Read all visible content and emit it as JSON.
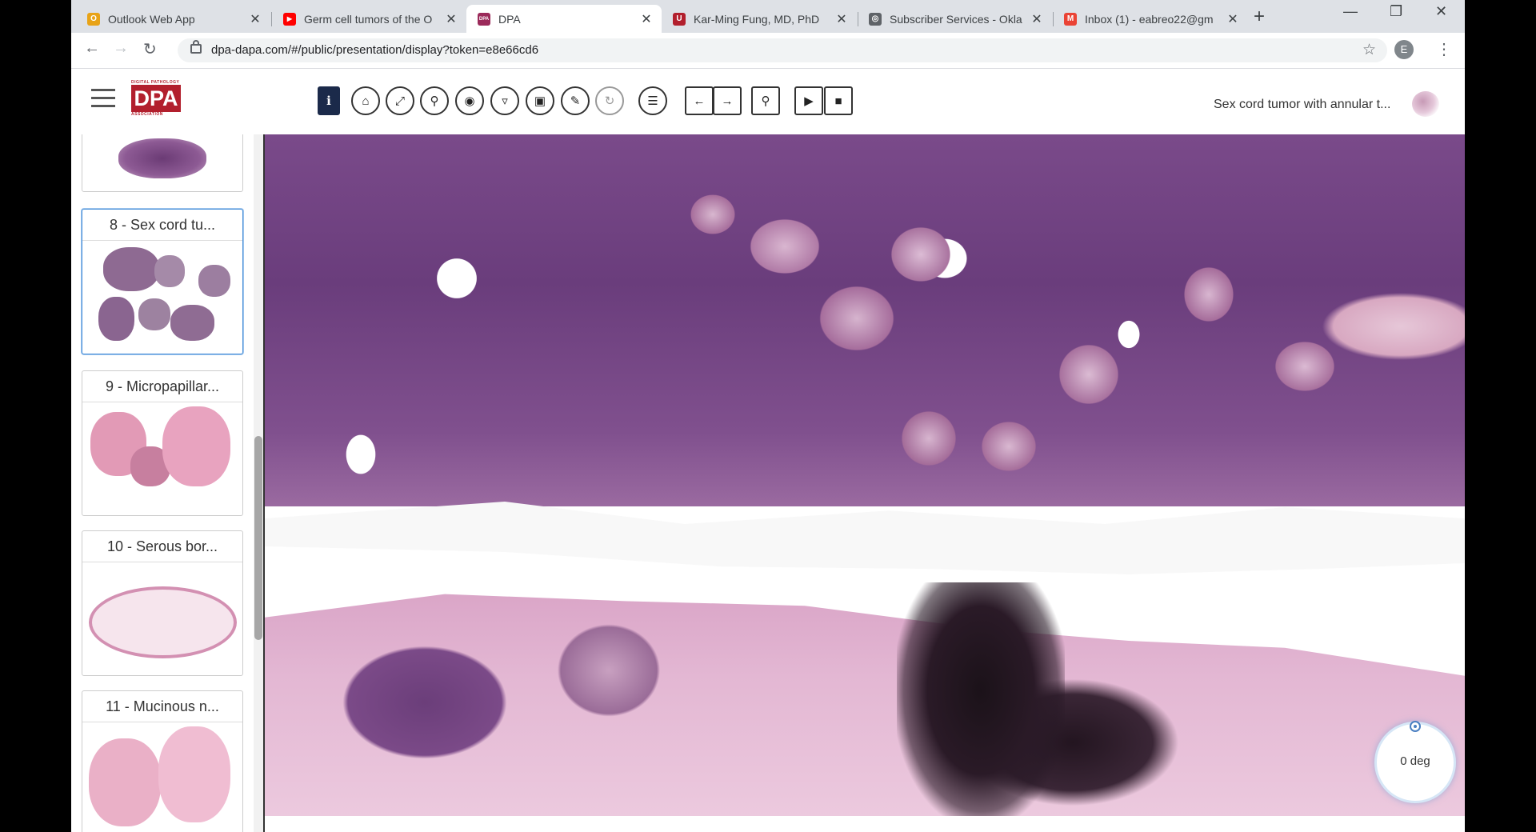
{
  "browser": {
    "tabs": [
      {
        "title": "Outlook Web App",
        "favicon": "outlook-icon",
        "fav_color": "#e8a317",
        "fav_text": "O"
      },
      {
        "title": "Germ cell tumors of the O",
        "favicon": "youtube-icon",
        "fav_color": "#ff0000",
        "fav_text": "▶"
      },
      {
        "title": "DPA",
        "favicon": "dpa-icon",
        "fav_color": "#9b2a5a",
        "fav_text": "DPA",
        "active": true
      },
      {
        "title": "Kar-Ming Fung, MD, PhD",
        "favicon": "ou-icon",
        "fav_color": "#b21f2d",
        "fav_text": "U"
      },
      {
        "title": "Subscriber Services - Okla",
        "favicon": "globe-icon",
        "fav_color": "#5f6368",
        "fav_text": "◎"
      },
      {
        "title": "Inbox (1) - eabreo22@gm",
        "favicon": "gmail-icon",
        "fav_color": "#ea4335",
        "fav_text": "M"
      }
    ],
    "new_tab": "+",
    "url": "dpa-dapa.com/#/public/presentation/display?token=e8e66cd6",
    "profile_initial": "E"
  },
  "app": {
    "logo_small": "DIGITAL PATHOLOGY",
    "logo_big": "DPA",
    "logo_bottom": "ASSOCIATION",
    "slide_title": "Sex cord tumor with annular t...",
    "rotation": "0 deg"
  },
  "sidebar": {
    "slides": [
      {
        "label": "8 - Sex cord tu...",
        "selected": true
      },
      {
        "label": "9 - Micropapillar..."
      },
      {
        "label": "10 - Serous bor..."
      },
      {
        "label": "11 - Mucinous n..."
      }
    ]
  },
  "colors": {
    "accent": "#b21f2d",
    "info_button": "#1b2a4a",
    "selection": "#4a90d9"
  }
}
